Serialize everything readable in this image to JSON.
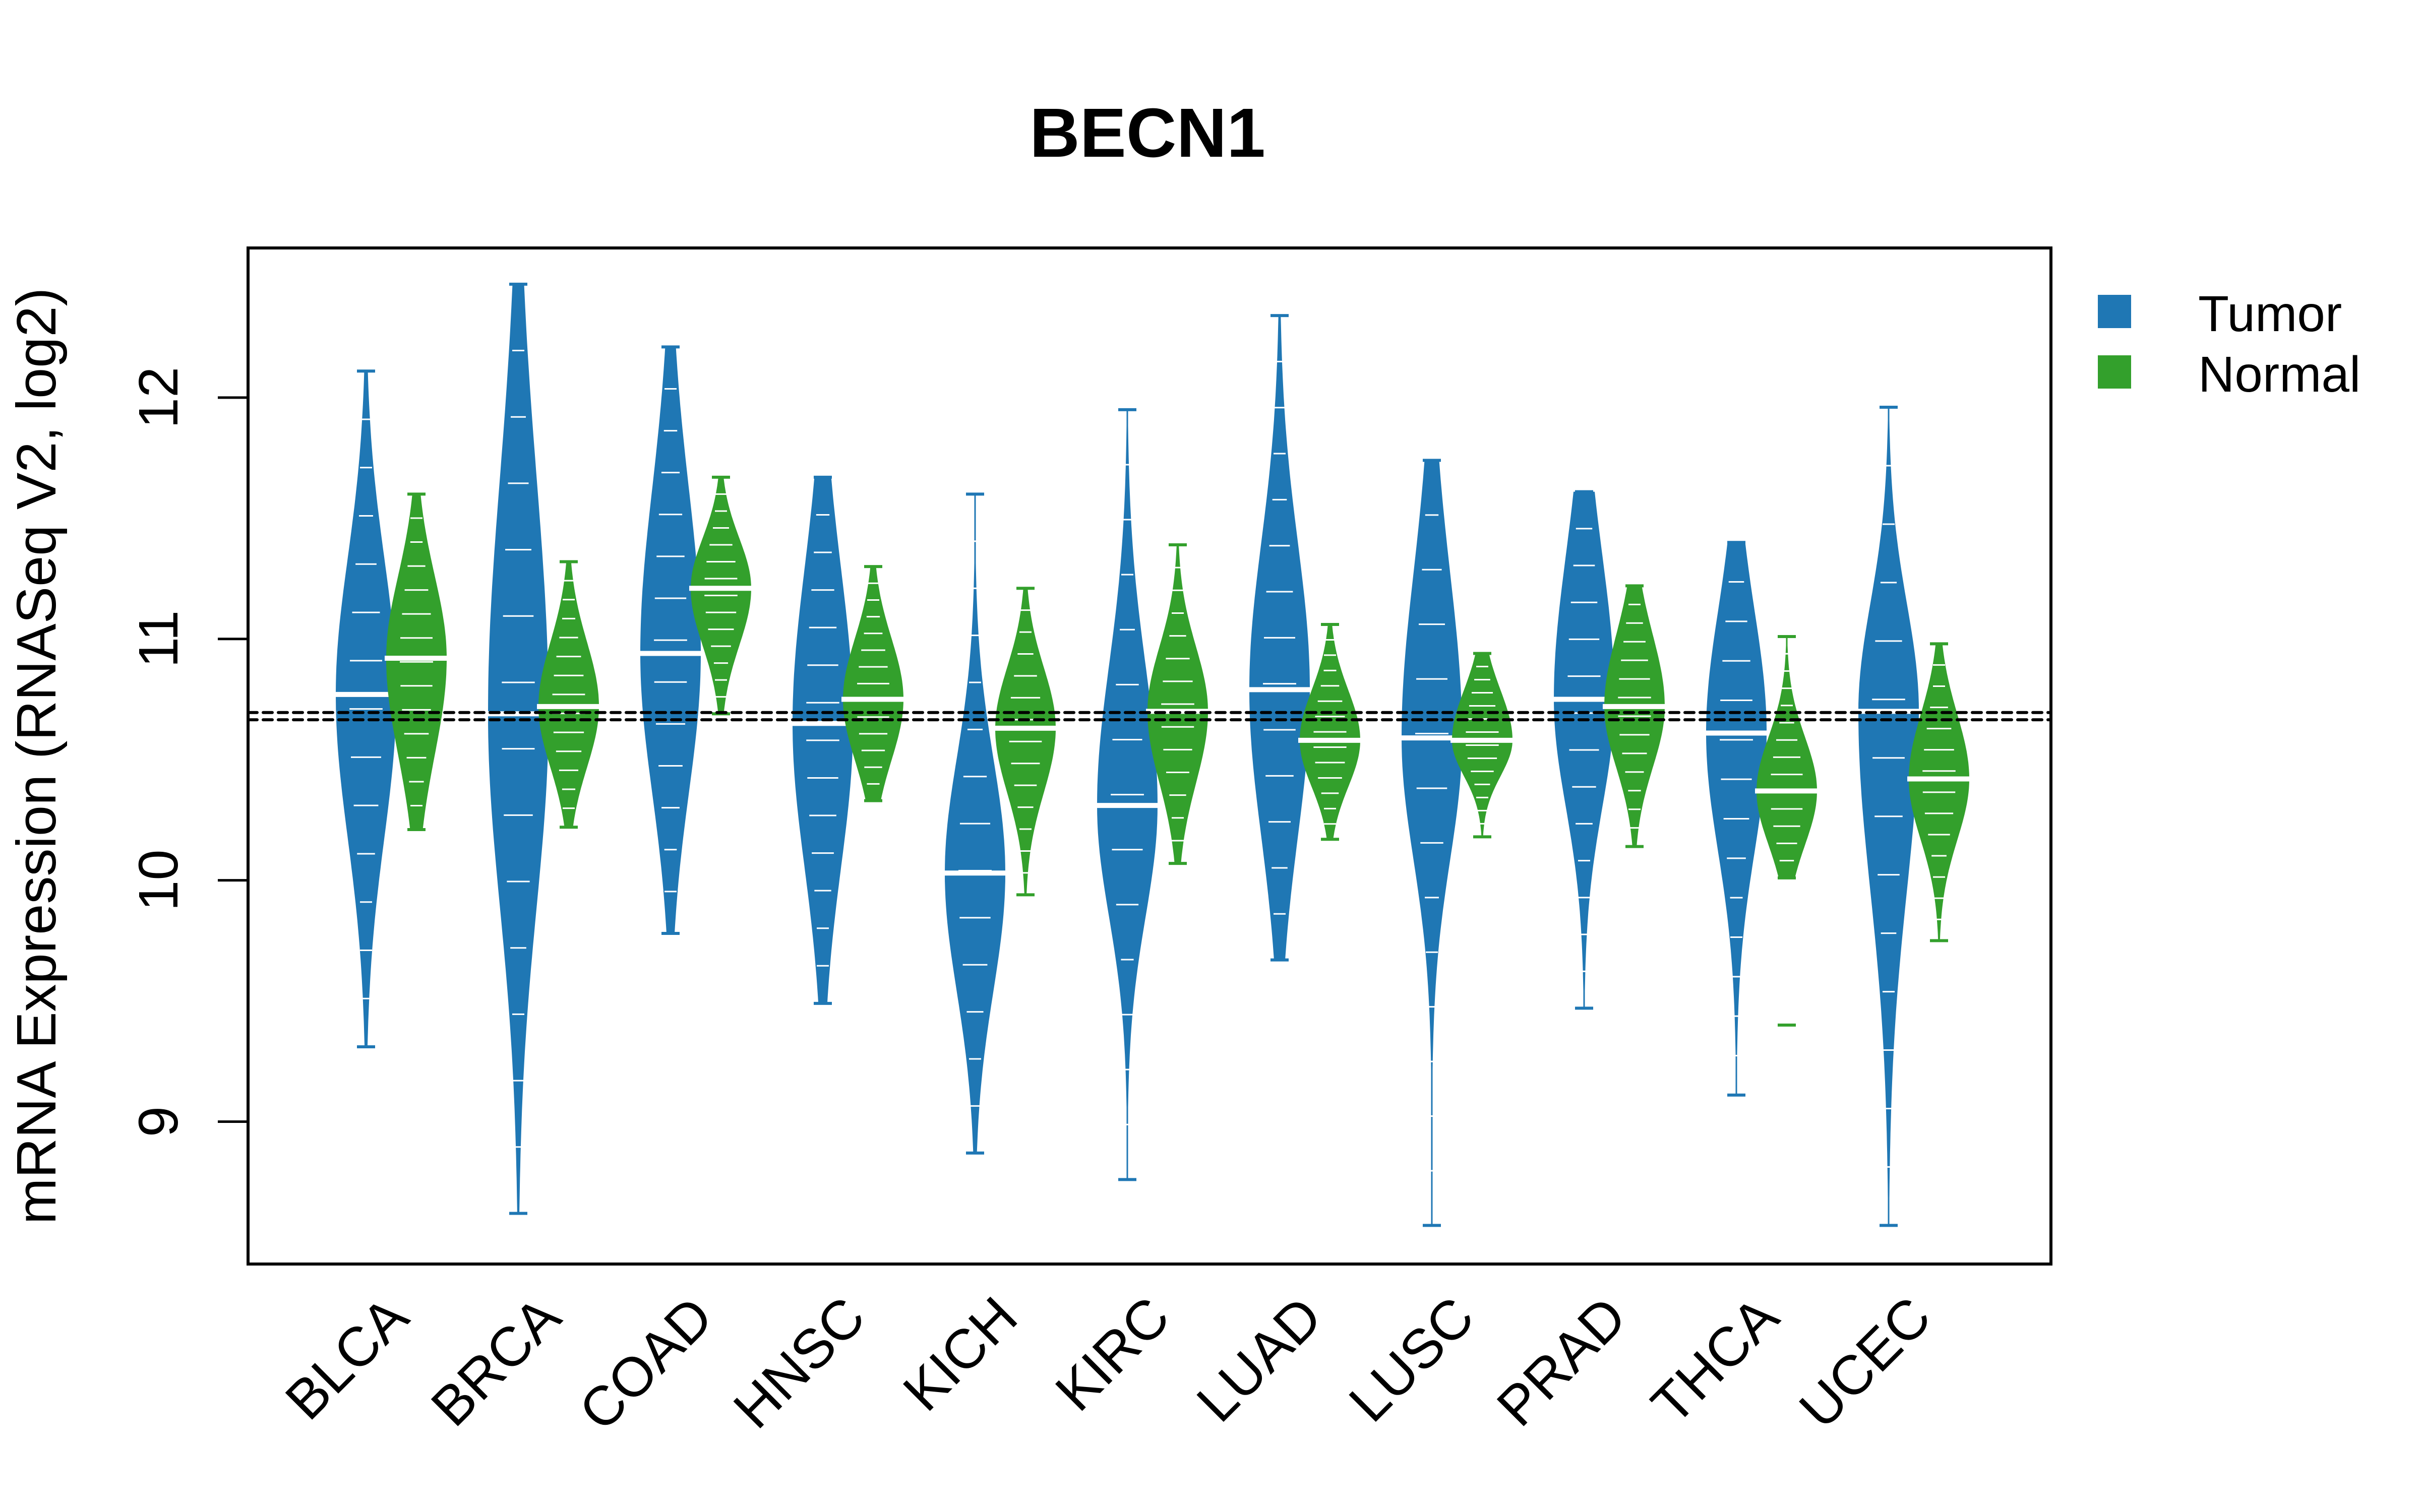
{
  "chart_data": {
    "type": "violin",
    "title": "BECN1",
    "xlabel": "",
    "ylabel": "mRNA Expression (RNASeq V2, log2)",
    "ylim": [
      8.41,
      12.62
    ],
    "yticks": [
      9,
      10,
      11,
      12
    ],
    "ytick_labels": [
      "9",
      "10",
      "11",
      "12"
    ],
    "grid": false,
    "legend": {
      "position": "right-top",
      "entries": [
        {
          "name": "Tumor",
          "color": "#1F77B4"
        },
        {
          "name": "Normal",
          "color": "#33A02C"
        }
      ]
    },
    "reference_lines": [
      {
        "y": 10.695,
        "style": "dashed",
        "color": "#000000"
      },
      {
        "y": 10.665,
        "style": "dashed",
        "color": "#000000"
      }
    ],
    "categories": [
      "BLCA",
      "BRCA",
      "COAD",
      "HNSC",
      "KICH",
      "KIRC",
      "LUAD",
      "LUSC",
      "PRAD",
      "THCA",
      "UCEC"
    ],
    "series": [
      {
        "name": "Tumor",
        "color": "#1F77B4",
        "values": [
          {
            "min": 9.31,
            "q1": 10.37,
            "median": 10.77,
            "q3": 11.15,
            "max": 12.11
          },
          {
            "min": 8.62,
            "q1": 10.15,
            "median": 10.69,
            "q3": 11.35,
            "max": 12.47
          },
          {
            "min": 9.78,
            "q1": 10.55,
            "median": 10.94,
            "q3": 11.4,
            "max": 12.21
          },
          {
            "min": 9.49,
            "q1": 10.25,
            "median": 10.65,
            "q3": 11.08,
            "max": 11.67
          },
          {
            "min": 8.87,
            "q1": 9.7,
            "median": 10.03,
            "q3": 10.35,
            "max": 11.6
          },
          {
            "min": 8.76,
            "q1": 10.0,
            "median": 10.31,
            "q3": 10.7,
            "max": 11.95
          },
          {
            "min": 9.67,
            "q1": 10.38,
            "median": 10.79,
            "q3": 11.2,
            "max": 12.34
          },
          {
            "min": 8.57,
            "q1": 10.25,
            "median": 10.59,
            "q3": 11.05,
            "max": 11.74
          },
          {
            "min": 9.47,
            "q1": 10.45,
            "median": 10.75,
            "q3": 11.15,
            "max": 11.61
          },
          {
            "min": 9.11,
            "q1": 10.28,
            "median": 10.61,
            "q3": 10.95,
            "max": 11.4
          },
          {
            "min": 8.57,
            "q1": 10.2,
            "median": 10.7,
            "q3": 11.0,
            "max": 11.96
          }
        ]
      },
      {
        "name": "Normal",
        "color": "#33A02C",
        "values": [
          {
            "min": 10.21,
            "q1": 10.65,
            "median": 10.92,
            "q3": 11.15,
            "max": 11.6
          },
          {
            "min": 10.22,
            "q1": 10.55,
            "median": 10.72,
            "q3": 10.9,
            "max": 11.32
          },
          {
            "min": 10.69,
            "q1": 11.05,
            "median": 11.21,
            "q3": 11.35,
            "max": 11.67
          },
          {
            "min": 10.33,
            "q1": 10.58,
            "median": 10.75,
            "q3": 10.92,
            "max": 11.3
          },
          {
            "min": 9.94,
            "q1": 10.45,
            "median": 10.63,
            "q3": 10.8,
            "max": 11.21
          },
          {
            "min": 10.07,
            "q1": 10.5,
            "median": 10.7,
            "q3": 10.88,
            "max": 11.39
          },
          {
            "min": 10.17,
            "q1": 10.45,
            "median": 10.58,
            "q3": 10.72,
            "max": 11.06
          },
          {
            "min": 10.18,
            "q1": 10.48,
            "median": 10.58,
            "q3": 10.72,
            "max": 10.94
          },
          {
            "min": 10.14,
            "q1": 10.55,
            "median": 10.72,
            "q3": 10.92,
            "max": 11.22
          },
          {
            "min": 10.01,
            "q1": 10.22,
            "median": 10.37,
            "q3": 10.52,
            "max": 11.01,
            "outliers": [
              9.4
            ]
          },
          {
            "min": 9.75,
            "q1": 10.25,
            "median": 10.42,
            "q3": 10.6,
            "max": 10.98
          }
        ]
      }
    ]
  }
}
